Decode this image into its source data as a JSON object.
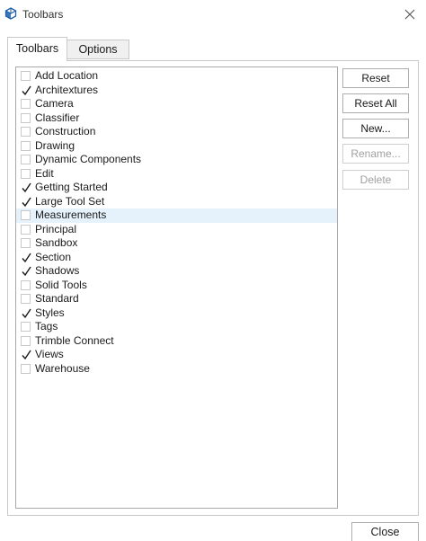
{
  "window": {
    "title": "Toolbars"
  },
  "tabs": [
    {
      "label": "Toolbars",
      "active": true
    },
    {
      "label": "Options",
      "active": false
    }
  ],
  "toolbar_list": {
    "selected_item": "Measurements",
    "items": [
      {
        "label": "Add Location",
        "checked": false
      },
      {
        "label": "Architextures",
        "checked": true
      },
      {
        "label": "Camera",
        "checked": false
      },
      {
        "label": "Classifier",
        "checked": false
      },
      {
        "label": "Construction",
        "checked": false
      },
      {
        "label": "Drawing",
        "checked": false
      },
      {
        "label": "Dynamic Components",
        "checked": false
      },
      {
        "label": "Edit",
        "checked": false
      },
      {
        "label": "Getting Started",
        "checked": true
      },
      {
        "label": "Large Tool Set",
        "checked": true
      },
      {
        "label": "Measurements",
        "checked": false
      },
      {
        "label": "Principal",
        "checked": false
      },
      {
        "label": "Sandbox",
        "checked": false
      },
      {
        "label": "Section",
        "checked": true
      },
      {
        "label": "Shadows",
        "checked": true
      },
      {
        "label": "Solid Tools",
        "checked": false
      },
      {
        "label": "Standard",
        "checked": false
      },
      {
        "label": "Styles",
        "checked": true
      },
      {
        "label": "Tags",
        "checked": false
      },
      {
        "label": "Trimble Connect",
        "checked": false
      },
      {
        "label": "Views",
        "checked": true
      },
      {
        "label": "Warehouse",
        "checked": false
      }
    ]
  },
  "buttons": {
    "reset": {
      "label": "Reset",
      "enabled": true
    },
    "reset_all": {
      "label": "Reset All",
      "enabled": true
    },
    "new": {
      "label": "New...",
      "enabled": true
    },
    "rename": {
      "label": "Rename...",
      "enabled": false
    },
    "delete": {
      "label": "Delete",
      "enabled": false
    },
    "close": {
      "label": "Close",
      "enabled": true
    }
  },
  "colors": {
    "selection": "#e5f1fb",
    "app_icon": "#1f5fa8"
  }
}
